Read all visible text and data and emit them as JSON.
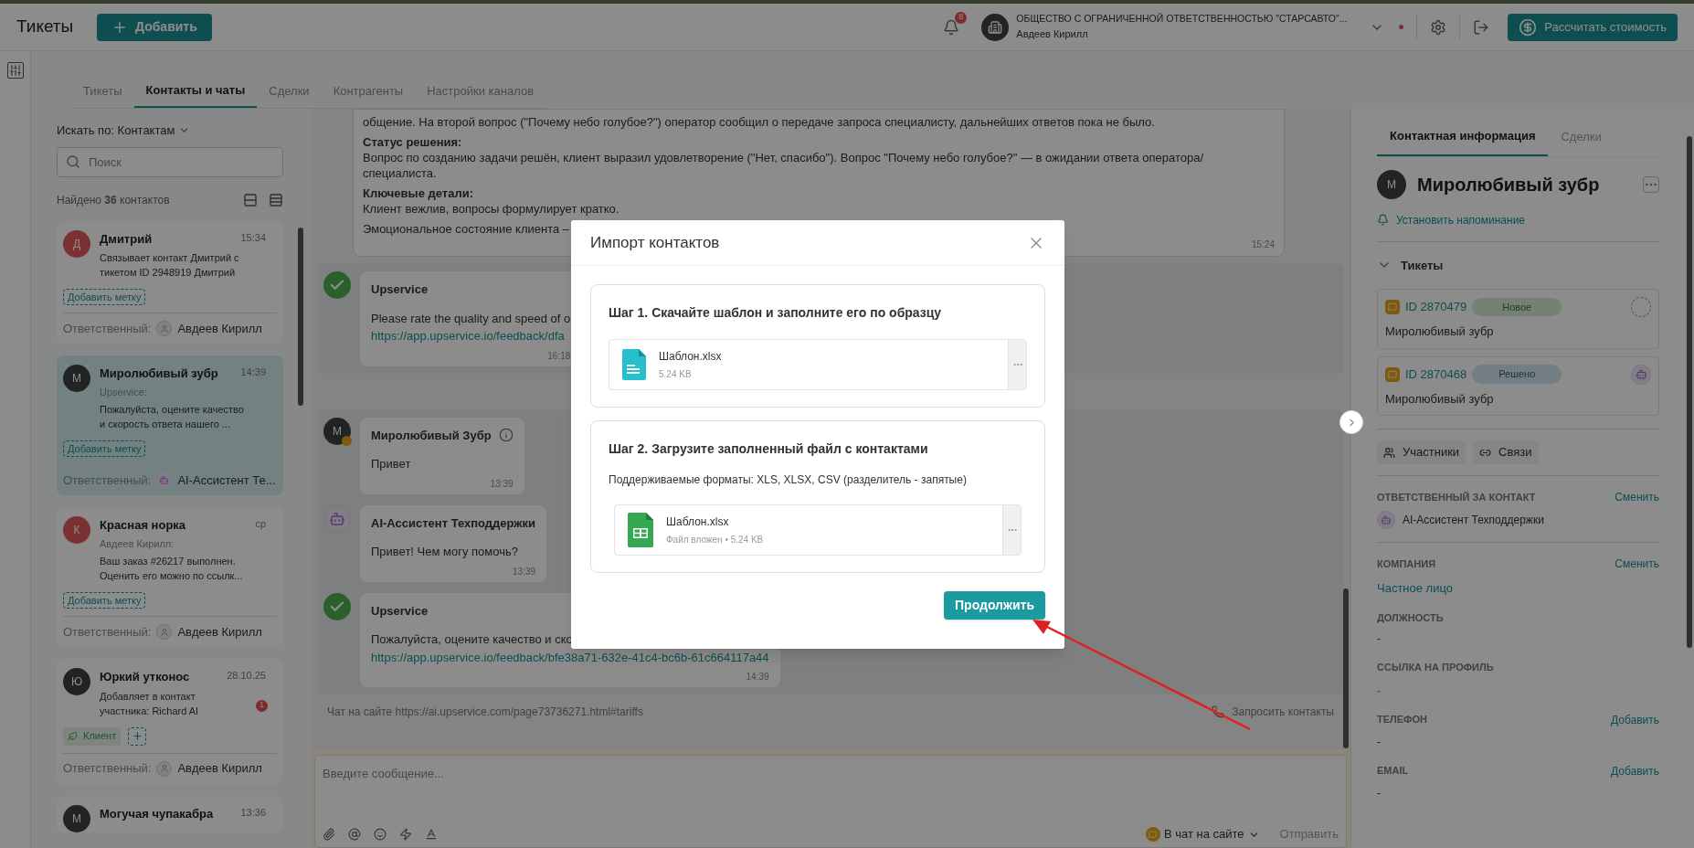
{
  "header": {
    "title": "Тикеты",
    "add_button": "Добавить",
    "notifications": "8",
    "company": "ОБЩЕСТВО С ОГРАНИЧЕННОЙ ОТВЕТСТВЕННОСТЬЮ \"СТАРСАВТО\"...",
    "user": "Авдеев Кирилл",
    "calc_button": "Рассчитать стоимость"
  },
  "tabs": [
    {
      "label": "Тикеты",
      "selected": false
    },
    {
      "label": "Контакты и чаты",
      "selected": true
    },
    {
      "label": "Сделки",
      "selected": false
    },
    {
      "label": "Контрагенты",
      "selected": false
    },
    {
      "label": "Настройки каналов",
      "selected": false
    }
  ],
  "contacts_panel": {
    "search_by": "Искать по: Контактам",
    "search_placeholder": "Поиск",
    "found": "Найдено **36** контактов",
    "contacts": [
      {
        "avatar": {
          "initial": "Д",
          "kind": "warm"
        },
        "name": "Дмитрий",
        "time": "15:34",
        "preview": "Связывает контакт Дмитрий с тикетом ID 2948919 Дмитрий",
        "add_tag": "Добавить метку",
        "responsible_label": "Ответственный:",
        "responsible": {
          "name": "Авдеев Кирилл",
          "kind": "person"
        },
        "selected": false
      },
      {
        "avatar": {
          "initial": "М",
          "kind": "dark"
        },
        "name": "Миролюбивый зубр",
        "time": "14:39",
        "sender": "Upservice:",
        "preview": "Пожалуйста, оцените качество и скорость ответа нашего ...",
        "add_tag": "Добавить метку",
        "responsible_label": "Ответственный:",
        "responsible": {
          "name": "AI-Ассистент Те...",
          "kind": "bot"
        },
        "selected": true
      },
      {
        "avatar": {
          "initial": "К",
          "kind": "warm"
        },
        "name": "Красная норка",
        "time": "ср",
        "sender": "Авдеев Кирилл:",
        "preview": "Ваш заказ #26217 выполнен. Оценить его можно по ссылк...",
        "add_tag": "Добавить метку",
        "responsible_label": "Ответственный:",
        "responsible": {
          "name": "Авдеев Кирилл",
          "kind": "person"
        },
        "selected": false
      },
      {
        "avatar": {
          "initial": "Ю",
          "kind": "dark"
        },
        "name": "Юркий утконос",
        "time": "28.10.25",
        "preview": "Добавляет в контакт участника: Richard AI",
        "unread": "1",
        "tags": [
          {
            "label": "Клиент"
          }
        ],
        "responsible_label": "Ответственный:",
        "responsible": {
          "name": "Авдеев Кирилл",
          "kind": "person"
        },
        "selected": false
      },
      {
        "avatar": {
          "initial": "М",
          "kind": "dark"
        },
        "name": "Могучая чупакабра",
        "time": "13:36",
        "selected": false
      }
    ]
  },
  "chat": {
    "summary": {
      "paragraphs": [
        {
          "text": "общение. На второй вопрос (\"Почему небо голубое?\") оператор сообщил о передаче запроса специалисту, дальнейших ответов пока не было."
        },
        {
          "heading": "Статус решения:",
          "text": "Вопрос по созданию задачи решён, клиент выразил удовлетворение (\"Нет, спасибо\"). Вопрос \"Почему небо голубое?\" — в ожидании ответа оператора/специалиста."
        },
        {
          "heading": "Ключевые детали:",
          "text": "Клиент вежлив, вопросы формулирует кратко."
        },
        {
          "text": "Эмоциональное состояние клиента –"
        }
      ],
      "time": "15:24"
    },
    "groups": [
      [
        {
          "author": "Upservice",
          "kind": "check",
          "text": "Please rate the quality and speed of o",
          "link": "https://app.upservice.io/feedback/dfa",
          "time": "16:18"
        }
      ],
      [
        {
          "author": "Миролюбивый Зубр",
          "kind": "initial",
          "initial": "М",
          "info": true,
          "text": "Привет",
          "time": "13:39"
        },
        {
          "author": "AI-Ассистент Техподдержки",
          "kind": "bot",
          "info": false,
          "text": "Привет! Чем могу помочь?",
          "time": "13:39"
        },
        {
          "author": "Upservice",
          "kind": "check",
          "info": false,
          "text": "Пожалуйста, оцените качество и ско",
          "link": "https://app.upservice.io/feedback/bfe38a71-632e-41c4-bc6b-61c664117a44",
          "time": "14:39"
        }
      ]
    ],
    "source": "Чат на сайте https://ai.upservice.com/page73736271.html#tariffs",
    "request_contacts": "Запросить контакты",
    "composer_placeholder": "Введите сообщение...",
    "channel": "В чат на сайте",
    "send": "Отправить"
  },
  "contact_info": {
    "tabs": [
      {
        "label": "Контактная информация",
        "selected": true
      },
      {
        "label": "Сделки",
        "selected": false
      }
    ],
    "initial": "М",
    "name": "Миролюбивый зубр",
    "reminder": "Установить напоминание",
    "tickets_title": "Тикеты",
    "tickets_expanded": true,
    "tickets": [
      {
        "id": "ID 2870479",
        "status": {
          "label": "Новое",
          "kind": "new"
        },
        "assignee": {
          "kind": "none"
        },
        "name": "Миролюбивый зубр"
      },
      {
        "id": "ID 2870468",
        "status": {
          "label": "Решено",
          "kind": "solved"
        },
        "assignee": {
          "kind": "bot"
        },
        "name": "Миролюбивый зубр"
      }
    ],
    "buttons": [
      {
        "label": "Участники",
        "kind": "members"
      },
      {
        "label": "Связи",
        "kind": "links"
      }
    ],
    "fields": [
      {
        "label": "ОТВЕТСТВЕННЫЙ ЗА КОНТАКТ",
        "action": "Сменить",
        "value": "AI-Ассистент Техподдержки",
        "kind": "assignee"
      },
      {
        "label": "КОМПАНИЯ",
        "action": "Сменить",
        "value": "Частное лицо",
        "kind": "link"
      },
      {
        "label": "ДОЛЖНОСТЬ",
        "value": "-",
        "kind": "text"
      },
      {
        "label": "ССЫЛКА НА ПРОФИЛЬ",
        "value": "-",
        "kind": "link"
      },
      {
        "label": "ТЕЛЕФОН",
        "action": "Добавить",
        "value": "-",
        "kind": "text"
      },
      {
        "label": "EMAIL",
        "action": "Добавить",
        "value": "-",
        "kind": "text"
      }
    ]
  },
  "import_dialog": {
    "title": "Импорт контактов",
    "steps": [
      {
        "title": "Шаг 1. Скачайте шаблон и заполните его по образцу",
        "file": {
          "name": "Шаблон.xlsx",
          "meta": "5.24 KB",
          "kind": "doc"
        }
      },
      {
        "title": "Шаг 2. Загрузите заполненный файл с контактами",
        "hint": "Поддерживаемые форматы: XLS, XLSX, CSV (разделитель - запятые)",
        "file": {
          "name": "Шаблон.xlsx",
          "meta": "Файл вложен • 5.24 KB",
          "kind": "sheet"
        }
      }
    ],
    "button": "Продолжить"
  }
}
